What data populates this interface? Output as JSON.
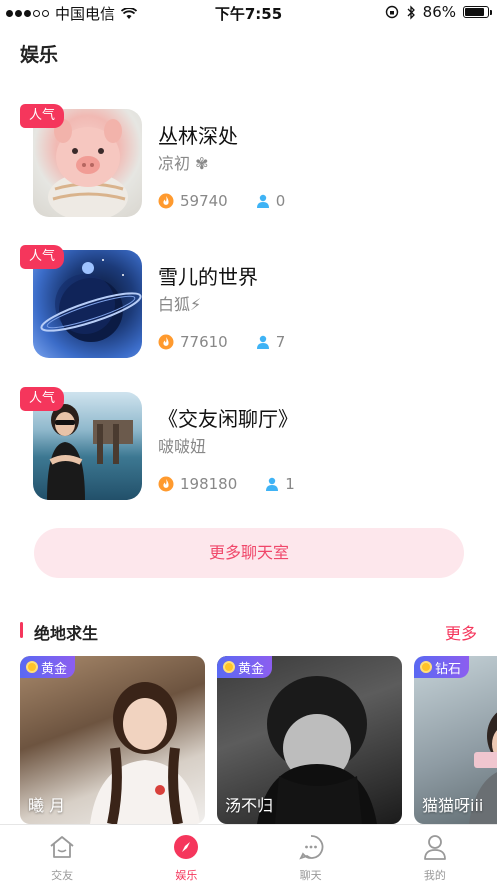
{
  "status_bar": {
    "carrier": "中国电信",
    "time": "下午7:55",
    "battery": "86%",
    "battery_level": 0.86
  },
  "page_title": "娱乐",
  "rooms": [
    {
      "badge": "人气",
      "name": "丛林深处",
      "host": "凉初 ✾",
      "heat": "59740",
      "users": "0",
      "thumb": "pig"
    },
    {
      "badge": "人气",
      "name": "雪儿的世界",
      "host": "白狐⚡",
      "heat": "77610",
      "users": "7",
      "thumb": "planet"
    },
    {
      "badge": "人气",
      "name": "《交友闲聊厅》",
      "host": "啵啵妞",
      "heat": "198180",
      "users": "1",
      "thumb": "girl"
    }
  ],
  "more_rooms_button": "更多聊天室",
  "section": {
    "title": "绝地求生",
    "more": "更多"
  },
  "cards": [
    {
      "tier": "黄金",
      "name": "曦  月"
    },
    {
      "tier": "黄金",
      "name": "汤不归"
    },
    {
      "tier": "钻石",
      "name": "猫猫呀iii"
    }
  ],
  "tabs": [
    {
      "label": "交友",
      "icon": "home-icon"
    },
    {
      "label": "娱乐",
      "icon": "compass-icon"
    },
    {
      "label": "聊天",
      "icon": "chat-icon"
    },
    {
      "label": "我的",
      "icon": "user-icon"
    }
  ],
  "colors": {
    "accent": "#f5365c",
    "heat": "#ff9a2e",
    "user": "#3fb3f5"
  }
}
